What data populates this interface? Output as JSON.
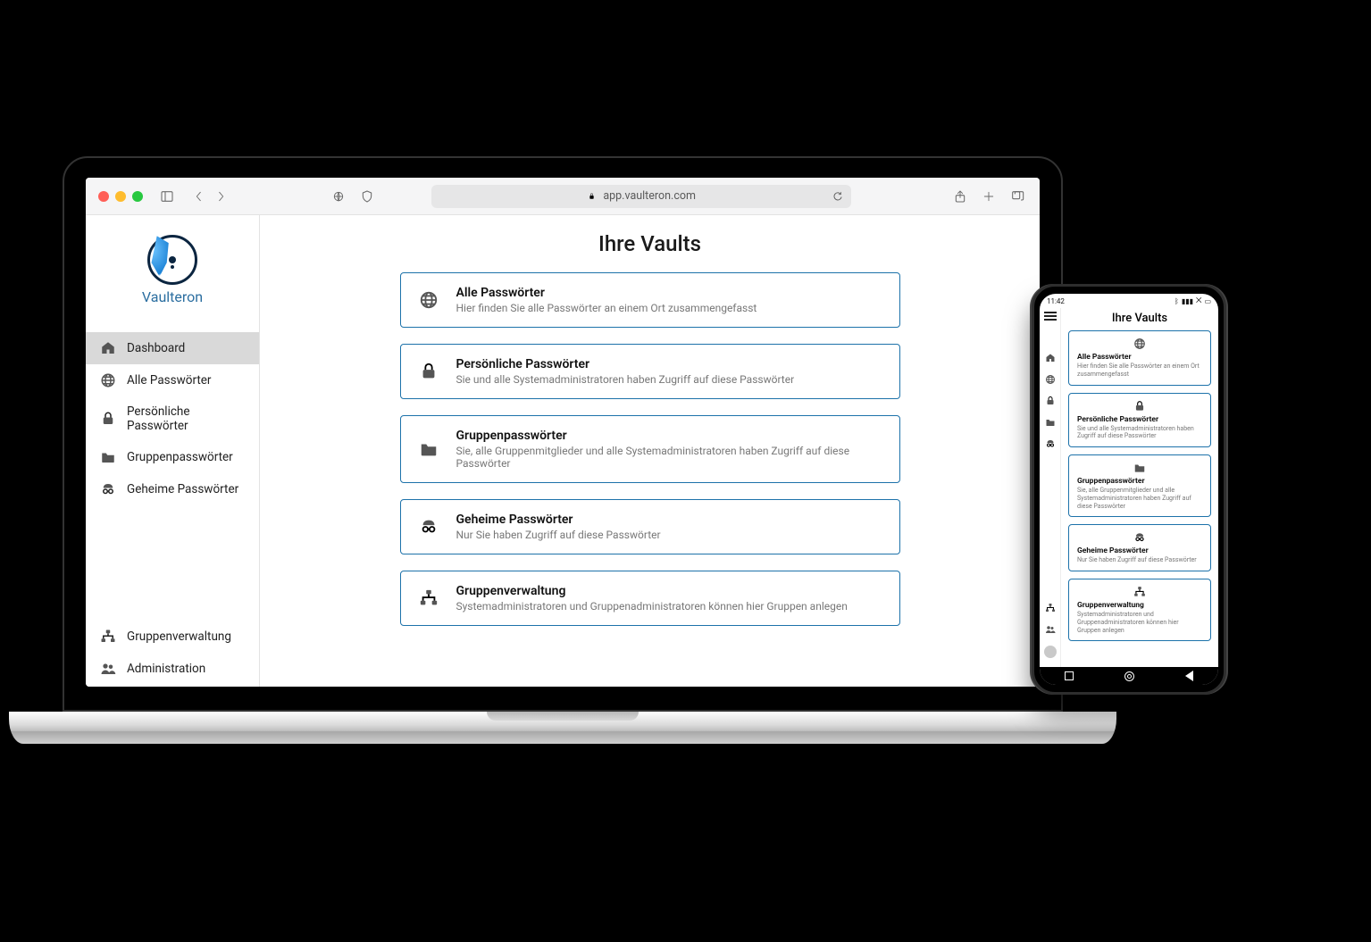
{
  "browser": {
    "url_display": "app.vaulteron.com"
  },
  "brand": {
    "name": "Vaulteron"
  },
  "sidebar": {
    "items": [
      {
        "label": "Dashboard",
        "icon": "home-icon",
        "active": true
      },
      {
        "label": "Alle Passwörter",
        "icon": "globe-icon"
      },
      {
        "label": "Persönliche Passwörter",
        "icon": "lock-icon"
      },
      {
        "label": "Gruppenpasswörter",
        "icon": "folder-icon"
      },
      {
        "label": "Geheime Passwörter",
        "icon": "incognito-icon"
      }
    ],
    "bottom": [
      {
        "label": "Gruppenverwaltung",
        "icon": "org-icon"
      },
      {
        "label": "Administration",
        "icon": "users-icon"
      }
    ]
  },
  "page": {
    "title": "Ihre Vaults",
    "cards": [
      {
        "icon": "globe-icon",
        "title": "Alle Passwörter",
        "desc": "Hier finden Sie alle Passwörter an einem Ort zusammengefasst"
      },
      {
        "icon": "lock-icon",
        "title": "Persönliche Passwörter",
        "desc": "Sie und alle Systemadministratoren haben Zugriff auf diese Passwörter"
      },
      {
        "icon": "folder-icon",
        "title": "Gruppenpasswörter",
        "desc": "Sie, alle Gruppenmitglieder und alle Systemadministratoren haben Zugriff auf diese Passwörter"
      },
      {
        "icon": "incognito-icon",
        "title": "Geheime Passwörter",
        "desc": "Nur Sie haben Zugriff auf diese Passwörter"
      },
      {
        "icon": "org-icon",
        "title": "Gruppenverwaltung",
        "desc": "Systemadministratoren und Gruppenadministratoren können hier Gruppen anlegen"
      }
    ]
  },
  "phone": {
    "status_time": "11:42",
    "title": "Ihre Vaults",
    "cards": [
      {
        "icon": "globe-icon",
        "title": "Alle Passwörter",
        "desc": "Hier finden Sie alle Passwörter an einem Ort zusammengefasst"
      },
      {
        "icon": "lock-icon",
        "title": "Persönliche Passwörter",
        "desc": "Sie und alle Systemadministratoren haben Zugriff auf diese Passwörter"
      },
      {
        "icon": "folder-icon",
        "title": "Gruppenpasswörter",
        "desc": "Sie, alle Gruppenmitglieder und alle Systemadministratoren haben Zugriff auf diese Passwörter"
      },
      {
        "icon": "incognito-icon",
        "title": "Geheime Passwörter",
        "desc": "Nur Sie haben Zugriff auf diese Passwörter"
      },
      {
        "icon": "org-icon",
        "title": "Gruppenverwaltung",
        "desc": "Systemadministratoren und Gruppenadministratoren können hier Gruppen anlegen"
      }
    ]
  }
}
